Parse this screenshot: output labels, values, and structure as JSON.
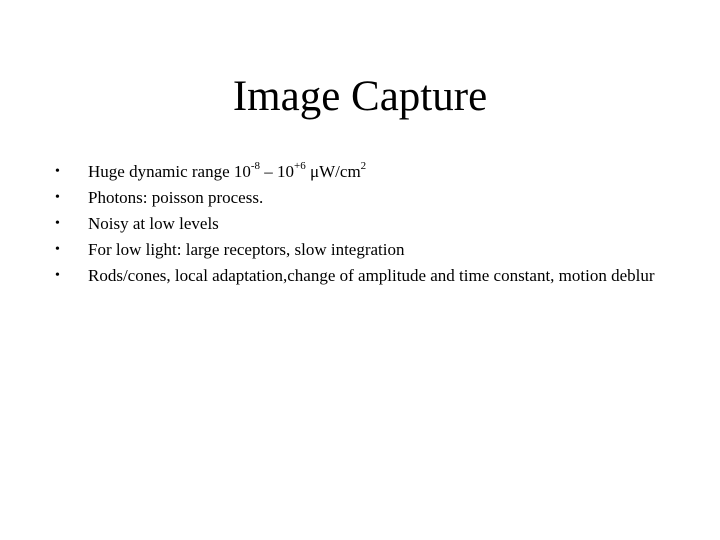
{
  "slide": {
    "title": "Image Capture",
    "bullet_symbol": "•",
    "bullets": [
      {
        "parts": {
          "a": "Huge dynamic range 10",
          "sup1": "-8",
          "b": " – 10",
          "sup2": "+6",
          "c": " μW/cm",
          "sup3": "2"
        }
      },
      {
        "text": "Photons: poisson process."
      },
      {
        "text": "Noisy at low levels"
      },
      {
        "text": "For low light: large receptors, slow integration"
      },
      {
        "text": "Rods/cones, local adaptation,change of amplitude and time constant, motion deblur"
      }
    ]
  }
}
